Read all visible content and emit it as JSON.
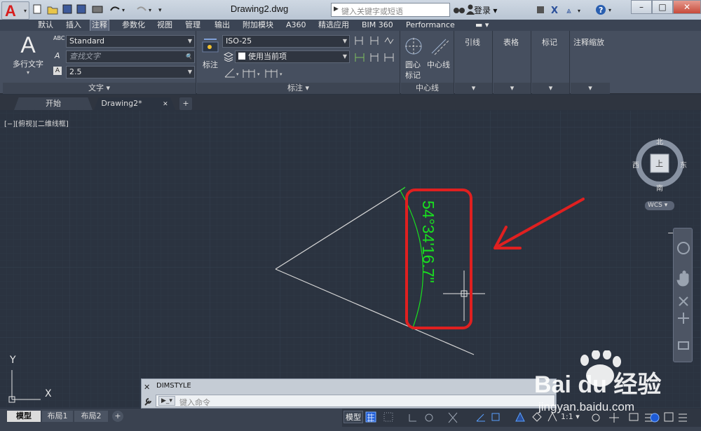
{
  "app": {
    "logo_letter": "A",
    "document_title": "Drawing2.dwg",
    "search_placeholder": "键入关键字或短语",
    "sign_in_label": "登录",
    "window_controls": [
      "–",
      "□",
      "✕"
    ]
  },
  "menu_tabs": [
    "默认",
    "插入",
    "注释",
    "参数化",
    "视图",
    "管理",
    "输出",
    "附加模块",
    "A360",
    "精选应用",
    "BIM 360",
    "Performance"
  ],
  "active_menu_tab": "注释",
  "ribbon": {
    "text_panel": {
      "big_button_glyph": "A",
      "big_button_label": "多行文字",
      "text_style_value": "Standard",
      "find_placeholder": "查找文字",
      "text_height_value": "2.5",
      "abc_label": "ABC",
      "title": "文字 ▾"
    },
    "dim_panel": {
      "dim_button_label": "标注",
      "dim_style_value": "ISO-25",
      "layer_value": "使用当前项",
      "title": "标注 ▾"
    },
    "centerline_panel": {
      "center_mark_label_line1": "圆心",
      "center_mark_label_line2": "标记",
      "centerline_label": "中心线",
      "title": "中心线"
    },
    "leader_panel": {
      "label": "引线"
    },
    "table_panel": {
      "label": "表格"
    },
    "markup_panel": {
      "label": "标记"
    },
    "annoscale_panel": {
      "label": "注释缩放"
    }
  },
  "file_tabs": {
    "start": "开始",
    "drawing": "Drawing2*",
    "close_glyph": "✕",
    "plus": "+"
  },
  "viewport": {
    "label": "[−][俯视][二维线框]",
    "dimension_text": "54°34'16.7\"",
    "viewcube": {
      "north": "北",
      "south": "南",
      "east": "东",
      "west": "西",
      "face": "上"
    },
    "wcs_label": "WCS ▾",
    "ucs_x": "X",
    "ucs_y": "Y",
    "restore_controls": "− ▢ ✕",
    "colors": {
      "dimension": "#19e01f",
      "lines": "#d6d6d6",
      "annotation": "#e02020",
      "background": "#2b3340"
    }
  },
  "command_line": {
    "history": "DIMSTYLE",
    "prompt_button": "▶_▾",
    "input_placeholder": "键入命令",
    "close_glyph": "✕",
    "wrench_icon": "wrench-icon"
  },
  "layout_tabs": [
    "模型",
    "布局1",
    "布局2",
    "+"
  ],
  "status_bar": {
    "model_label": "模型",
    "scale_label": "1:1 ▾"
  },
  "watermark": {
    "brand": "Bai du 经验",
    "url": "jingyan.baidu.com"
  }
}
